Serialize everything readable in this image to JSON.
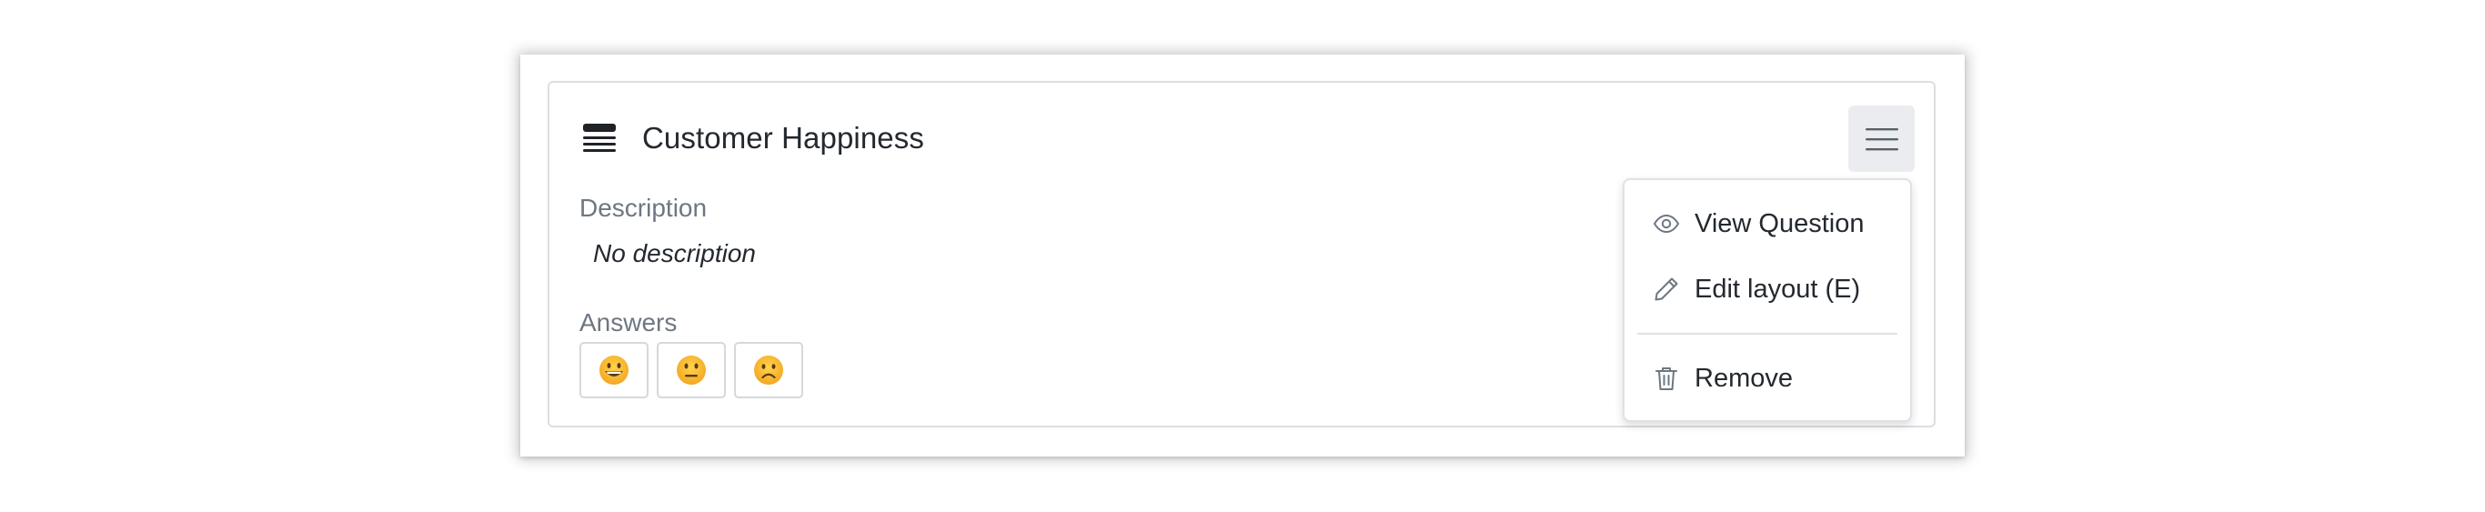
{
  "card": {
    "title": "Customer Happiness",
    "header_icon": "stacked-lines-icon",
    "menu_icon": "hamburger-menu-icon"
  },
  "description": {
    "label": "Description",
    "value": "No description"
  },
  "answers": {
    "label": "Answers",
    "options": [
      {
        "icon": "grinning-face-icon"
      },
      {
        "icon": "neutral-face-icon"
      },
      {
        "icon": "frowning-face-icon"
      }
    ]
  },
  "menu": {
    "items": [
      {
        "label": "View Question",
        "icon": "eye-icon"
      },
      {
        "label": "Edit layout (E)",
        "icon": "pencil-icon"
      },
      {
        "label": "Remove",
        "icon": "trash-icon"
      }
    ]
  },
  "colors": {
    "text": "#24292f",
    "muted": "#6e7781",
    "border": "#dcdee2",
    "menu_button_bg": "#ebecef",
    "emoji_yellow": "#f7b731"
  }
}
